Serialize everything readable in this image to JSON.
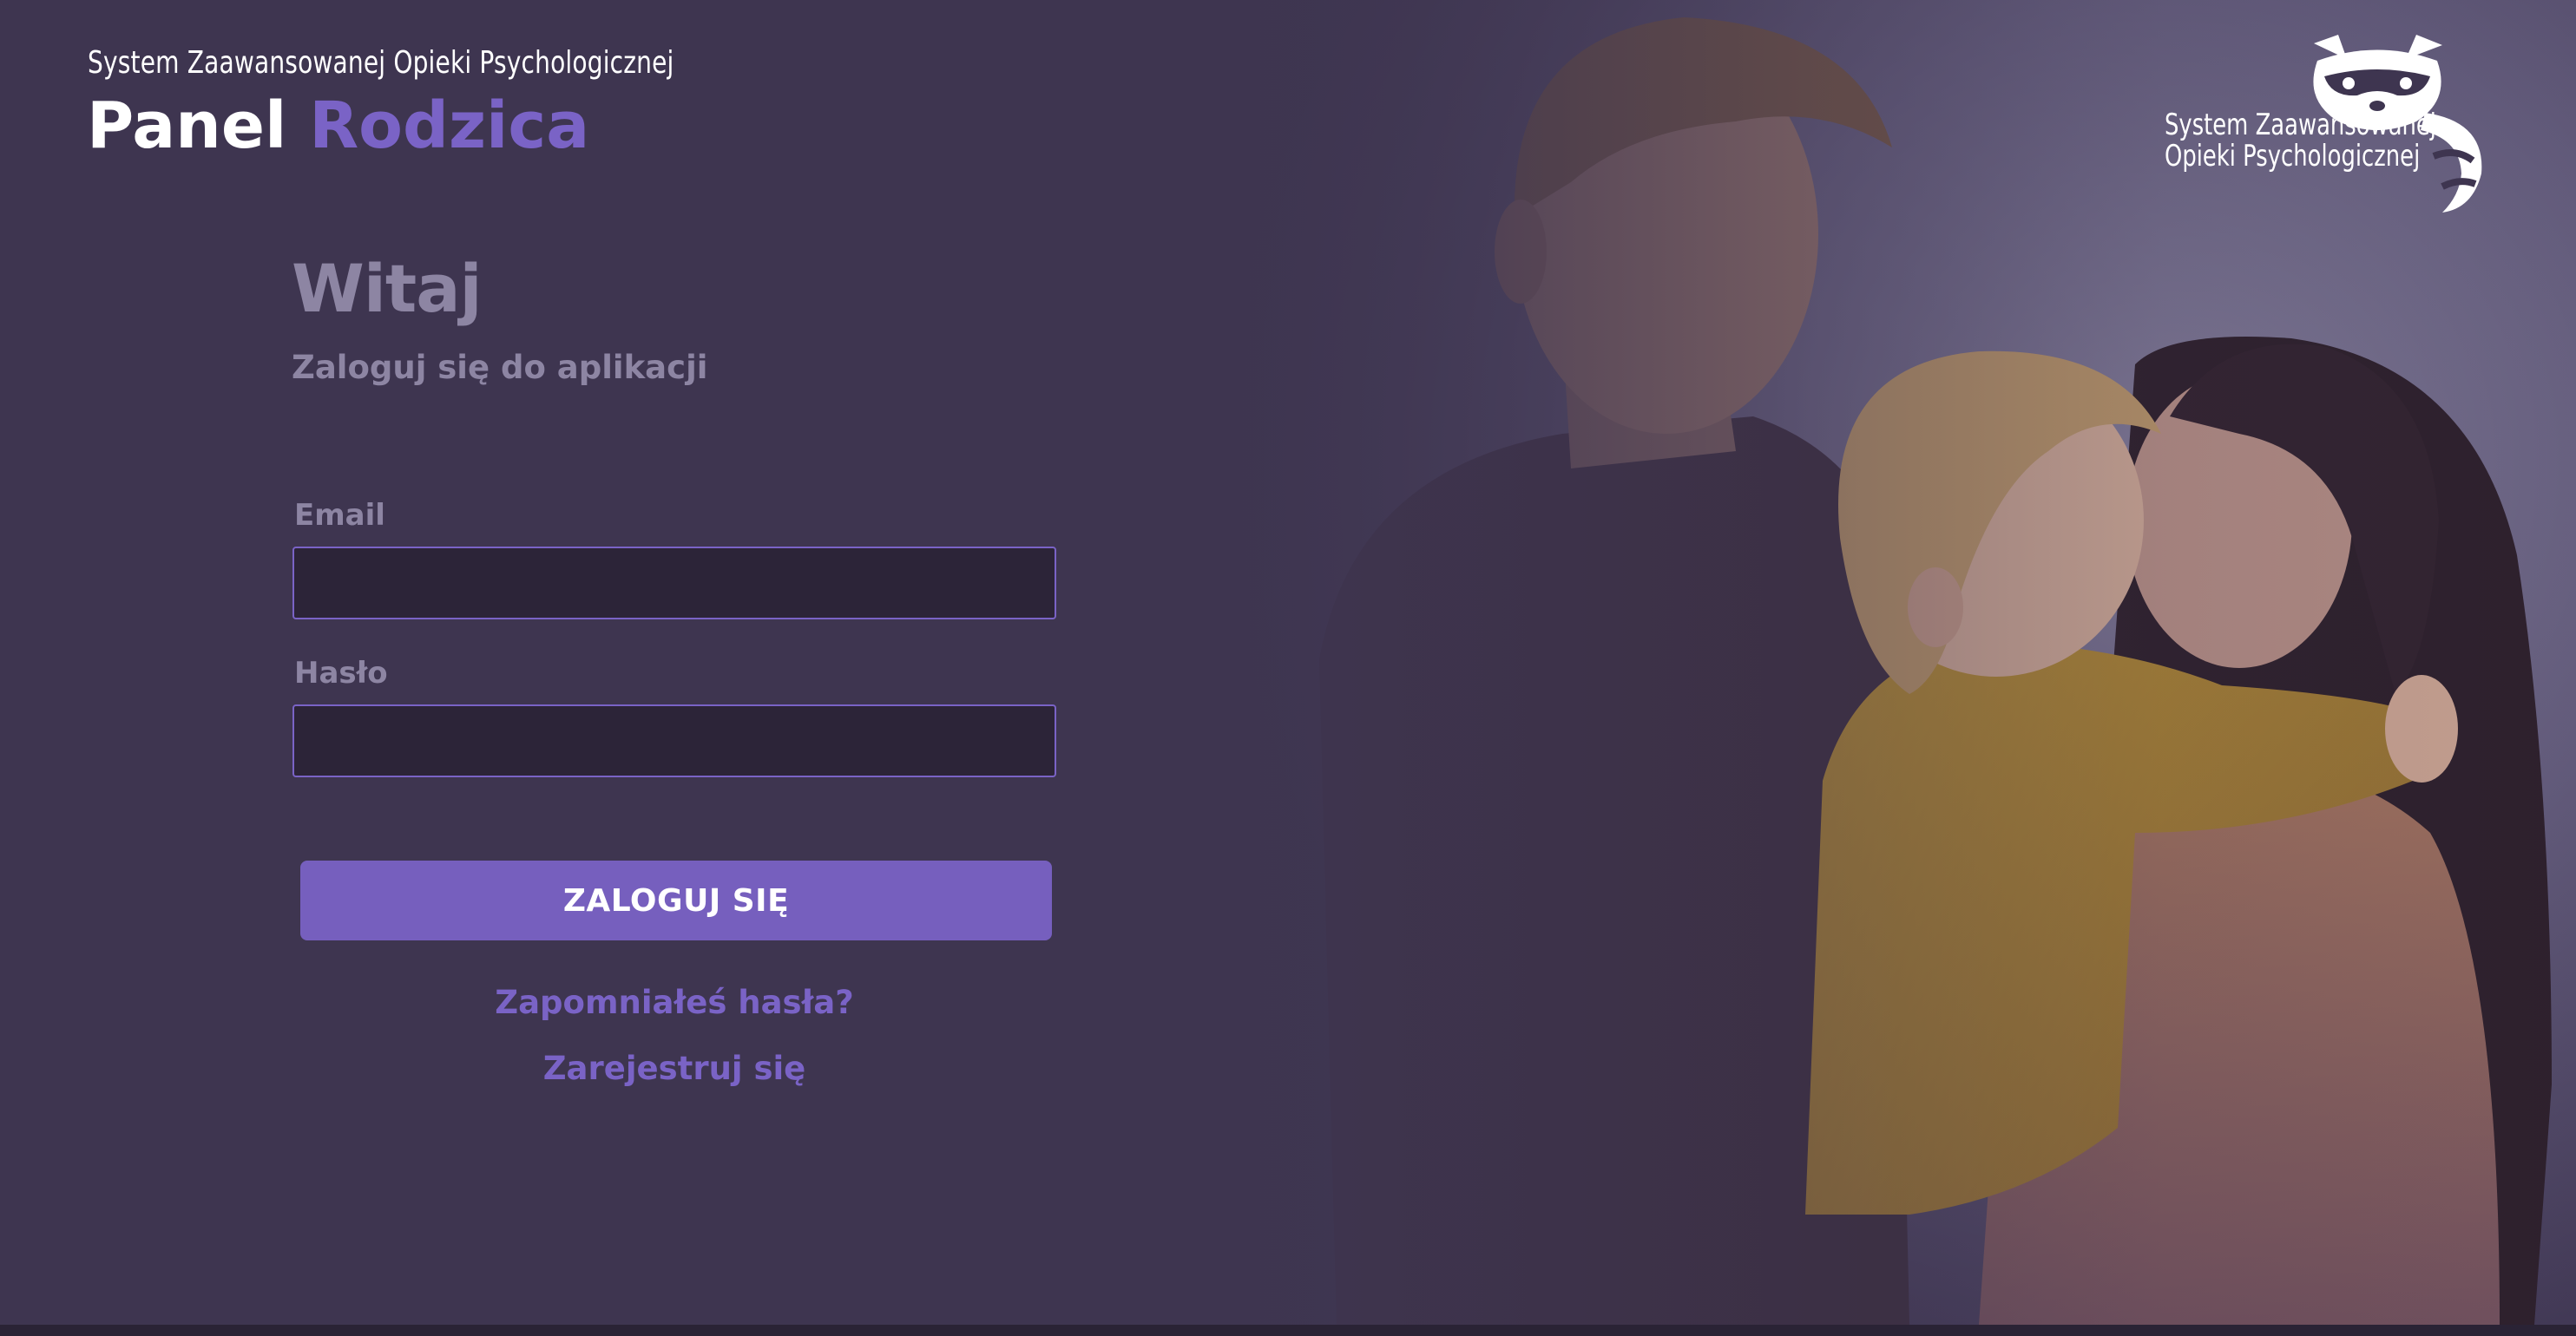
{
  "header": {
    "subtitle": "System Zaawansowanej Opieki Psychologicznej",
    "title_part1": "Panel",
    "title_part2": "Rodzica"
  },
  "brand": {
    "line1": "System Zaawansowanej",
    "line2": "Opieki Psychologicznej",
    "mascot_icon": "raccoon-icon"
  },
  "login": {
    "welcome": "Witaj",
    "prompt": "Zaloguj się do aplikacji",
    "email_label": "Email",
    "email_value": "",
    "password_label": "Hasło",
    "password_value": "",
    "submit_label": "ZALOGUJ SIĘ",
    "forgot_password": "Zapomniałeś hasła?",
    "register": "Zarejestruj się"
  },
  "colors": {
    "background": "#3e3550",
    "accent": "#765fbe",
    "input_background": "#2c2438",
    "muted_text": "#8d85a3",
    "white": "#ffffff"
  }
}
